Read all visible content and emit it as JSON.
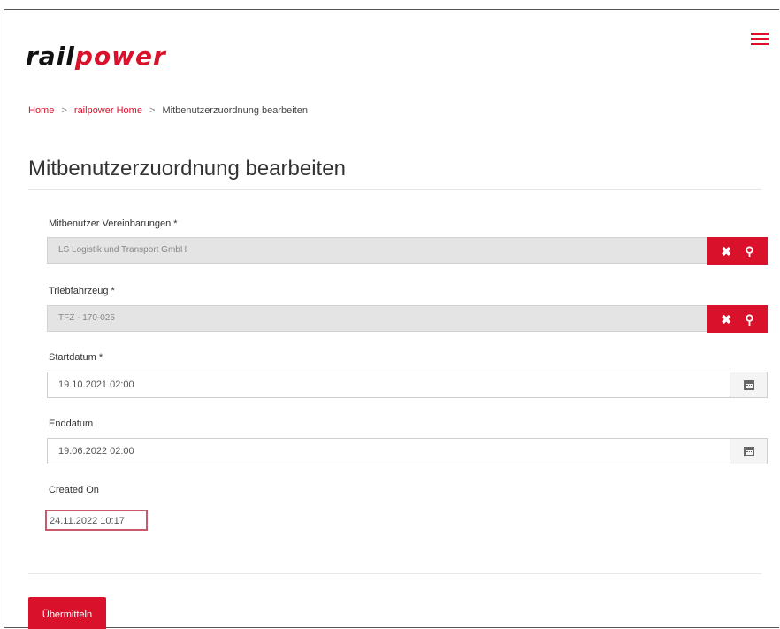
{
  "brand": {
    "part1": "rail",
    "part2": "power"
  },
  "breadcrumb": [
    {
      "label": "Home"
    },
    {
      "label": "railpower Home"
    },
    {
      "label": "Mitbenutzerzuordnung bearbeiten"
    }
  ],
  "breadcrumb_separator": ">",
  "page_title": "Mitbenutzerzuordnung bearbeiten",
  "form": {
    "agreement": {
      "label": "Mitbenutzer Vereinbarungen *",
      "value": "LS Logistik und Transport GmbH",
      "clear_icon": "✖",
      "search_icon": "⚲"
    },
    "vehicle": {
      "label": "Triebfahrzeug *",
      "value": "TFZ - 170-025",
      "clear_icon": "✖",
      "search_icon": "⚲"
    },
    "start": {
      "label": "Startdatum *",
      "value": "19.10.2021 02:00"
    },
    "end": {
      "label": "Enddatum",
      "value": "19.06.2022 02:00"
    },
    "created": {
      "label": "Created On",
      "value": "24.11.2022 10:17"
    }
  },
  "submit_label": "Übermitteln",
  "colors": {
    "accent": "#d9112b"
  }
}
